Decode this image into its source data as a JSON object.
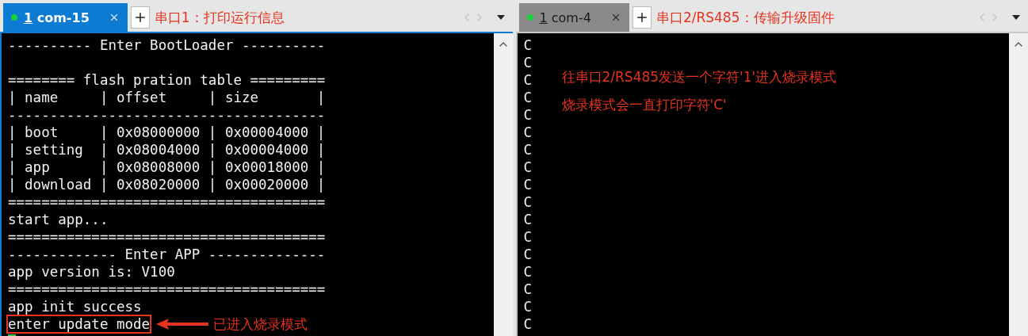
{
  "panes": [
    {
      "tab": {
        "number": "1",
        "label": "com-15",
        "selected": true,
        "connected": true
      },
      "title_note": "串口1：打印运行信息",
      "active": true,
      "lines": [
        {
          "text": "---------- Enter BootLoader ----------"
        },
        {
          "text": "======== flash pration table =========",
          "spaced": true
        },
        {
          "text": "| name     | offset     | size       |"
        },
        {
          "text": "--------------------------------------"
        },
        {
          "text": "| boot     | 0x08000000 | 0x00004000 |"
        },
        {
          "text": "| setting  | 0x08004000 | 0x00004000 |"
        },
        {
          "text": "| app      | 0x08008000 | 0x00018000 |"
        },
        {
          "text": "| download | 0x08020000 | 0x00020000 |"
        },
        {
          "text": "======================================"
        },
        {
          "text": "start app..."
        },
        {
          "text": "======================================"
        },
        {
          "text": "------------- Enter APP --------------"
        },
        {
          "text": "app version is: V100"
        },
        {
          "text": "======================================"
        },
        {
          "text": "app init success"
        },
        {
          "text": "enter update mode",
          "highlighted": true,
          "callout": "已进入烧录模式"
        }
      ],
      "cursor": true
    },
    {
      "tab": {
        "number": "1",
        "label": "com-4",
        "selected": false,
        "connected": true
      },
      "title_note": "串口2/RS485：传输升级固件",
      "active": false,
      "lines": [
        {
          "text": "C"
        },
        {
          "text": "C"
        },
        {
          "text": "C"
        },
        {
          "text": "C"
        },
        {
          "text": "C"
        },
        {
          "text": "C"
        },
        {
          "text": "C"
        },
        {
          "text": "C"
        },
        {
          "text": "C"
        },
        {
          "text": "C"
        },
        {
          "text": "C"
        },
        {
          "text": "C"
        },
        {
          "text": "C"
        },
        {
          "text": "C"
        },
        {
          "text": "C"
        },
        {
          "text": "C"
        },
        {
          "text": "C"
        }
      ],
      "notes": [
        "往串口2/RS485发送一个字符'1'进入烧录模式",
        "烧录模式会一直打印字符'C'"
      ]
    }
  ]
}
